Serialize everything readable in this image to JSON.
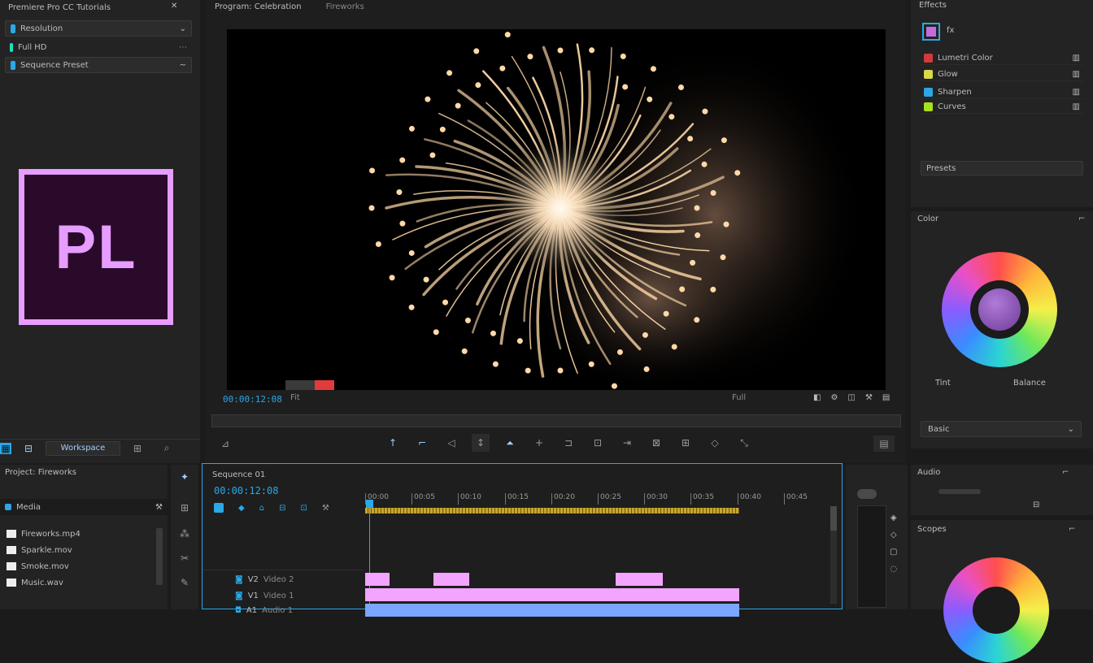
{
  "left_panel": {
    "title": "Premiere Pro CC Tutorials",
    "items": [
      {
        "label": "Resolution",
        "chev": "⌄"
      },
      {
        "label": "Full HD",
        "num": "⋯"
      },
      {
        "label": "Sequence Preset",
        "chev": "~"
      }
    ],
    "logo_text": "PL",
    "bottom_bar": {
      "label": "Workspace"
    }
  },
  "program_monitor": {
    "title": "Program: Celebration",
    "subtitle": "Fireworks",
    "timecode": "00:00:12:08",
    "fit": "Fit",
    "frame_label": "Full"
  },
  "right_panel": {
    "effects": [
      {
        "label": "Lumetri Color",
        "color": "#d33a3a"
      },
      {
        "label": "Glow",
        "color": "#d8d84a"
      },
      {
        "label": "Sharpen",
        "color": "#2aa8e8"
      },
      {
        "label": "Curves",
        "color": "#a8e01e"
      }
    ],
    "header_label": "Effects",
    "fx_icon_label": "fx",
    "preset_label": "Presets",
    "color_panel": {
      "title": "Color",
      "left_label": "Tint",
      "right_label": "Balance",
      "dropdown": "Basic"
    }
  },
  "project_panel": {
    "title": "Project: Fireworks",
    "tab": "Media",
    "items": [
      "Fireworks.mp4",
      "Sparkle.mov",
      "Smoke.mov",
      "Music.wav"
    ]
  },
  "timeline": {
    "title": "Sequence 01",
    "timecode": "00:00:12:08",
    "tracks": [
      {
        "name": "V2",
        "label": "Video 2"
      },
      {
        "name": "V1",
        "label": "Video 1"
      },
      {
        "name": "A1",
        "label": "Audio 1"
      }
    ],
    "ruler": [
      "00:00",
      "00:05",
      "00:10",
      "00:15",
      "00:20",
      "00:25",
      "00:30",
      "00:35",
      "00:40",
      "00:45"
    ]
  },
  "bottom_right": {
    "title": "Audio",
    "scopes_title": "Scopes"
  },
  "colors": {
    "accent": "#2aa8e8",
    "logo_border": "#e79cff",
    "logo_bg": "#2a0a2b",
    "clip_pink": "#f2a4ff",
    "clip_blue": "#7aa6ff",
    "playhead": "#2aa8e8"
  }
}
